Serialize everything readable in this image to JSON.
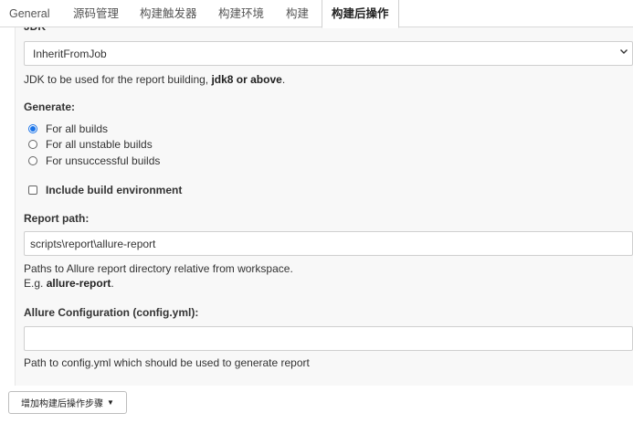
{
  "tabs": [
    {
      "label": "General",
      "active": false
    },
    {
      "label": "源码管理",
      "active": false
    },
    {
      "label": "构建触发器",
      "active": false
    },
    {
      "label": "构建环境",
      "active": false
    },
    {
      "label": "构建",
      "active": false
    },
    {
      "label": "构建后操作",
      "active": true
    }
  ],
  "jdk": {
    "label": "JDK",
    "selected": "InheritFromJob",
    "help_prefix": "JDK to be used for the report building, ",
    "help_bold": "jdk8 or above",
    "help_suffix": "."
  },
  "generate": {
    "label": "Generate:",
    "options": [
      {
        "label": "For all builds",
        "checked": true
      },
      {
        "label": "For all unstable builds",
        "checked": false
      },
      {
        "label": "For unsuccessful builds",
        "checked": false
      }
    ]
  },
  "include_env": {
    "label": "Include build environment",
    "checked": false
  },
  "report_path": {
    "label": "Report path:",
    "value": "scripts\\report\\allure-report",
    "help_line1": "Paths to Allure report directory relative from workspace.",
    "help_prefix": "E.g. ",
    "help_bold": "allure-report",
    "help_suffix": "."
  },
  "allure_config": {
    "label": "Allure Configuration (config.yml):",
    "value": "",
    "help": "Path to config.yml which should be used to generate report"
  },
  "add_step_button": {
    "label": "增加构建后操作步骤",
    "caret": "▼"
  },
  "colors": {
    "accent": "#1a73e8",
    "panel_bg": "#f8f8f8",
    "border": "#cfcfcf"
  }
}
